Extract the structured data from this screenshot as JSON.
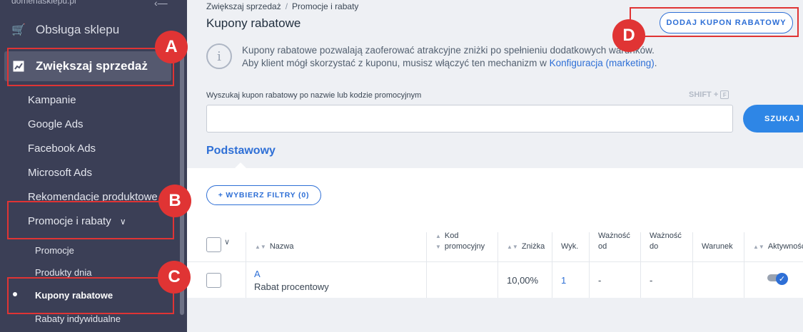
{
  "sidebar": {
    "top_label": "domenasklepu.pl",
    "store_service": "Obsługa sklepu",
    "increase_sales": "Zwiększaj sprzedaż",
    "items": [
      "Kampanie",
      "Google Ads",
      "Facebook Ads",
      "Microsoft Ads",
      "Rekomendacje produktowe"
    ],
    "promotions_group": "Promocje i rabaty",
    "subitems": [
      "Promocje",
      "Produkty dnia",
      "Kupony rabatowe",
      "Rabaty indywidualne"
    ]
  },
  "breadcrumb": {
    "parent": "Zwiększaj sprzedaż",
    "sep": "/",
    "current": "Promocje i rabaty"
  },
  "page_title": "Kupony rabatowe",
  "add_button": "DODAJ KUPON RABATOWY",
  "info": {
    "line1": "Kupony rabatowe pozwalają zaoferować atrakcyjne zniżki po spełnieniu dodatkowych warunków.",
    "line2_prefix": "Aby klient mógł skorzystać z kuponu, musisz włączyć ten mechanizm w ",
    "line2_link": "Konfiguracja (marketing)",
    "line2_suffix": "."
  },
  "search": {
    "label": "Wyszukaj kupon rabatowy po nazwie lub kodzie promocyjnym",
    "shortcut": "SHIFT +",
    "shortcut_key": "F",
    "button": "SZUKAJ"
  },
  "tab": "Podstawowy",
  "filter_button": "+ WYBIERZ FILTRY (0)",
  "table": {
    "headers": {
      "name": "Nazwa",
      "code_line1": "Kod",
      "code_line2": "promocyjny",
      "discount": "Zniżka",
      "used": "Wyk.",
      "valid_from_1": "Ważność",
      "valid_from_2": "od",
      "valid_to_1": "Ważność",
      "valid_to_2": "do",
      "condition": "Warunek",
      "active": "Aktywność"
    },
    "rows": [
      {
        "name": "A",
        "description": "Rabat procentowy",
        "code": "",
        "discount": "10,00%",
        "used": "1",
        "valid_from": "-",
        "valid_to": "-",
        "condition": "",
        "active": true
      }
    ]
  },
  "annotations": {
    "a": "A",
    "b": "B",
    "c": "C",
    "d": "D"
  },
  "colors": {
    "accent": "#2e6fd6",
    "annotation": "#e03434",
    "sidebar": "#3b3f56"
  }
}
